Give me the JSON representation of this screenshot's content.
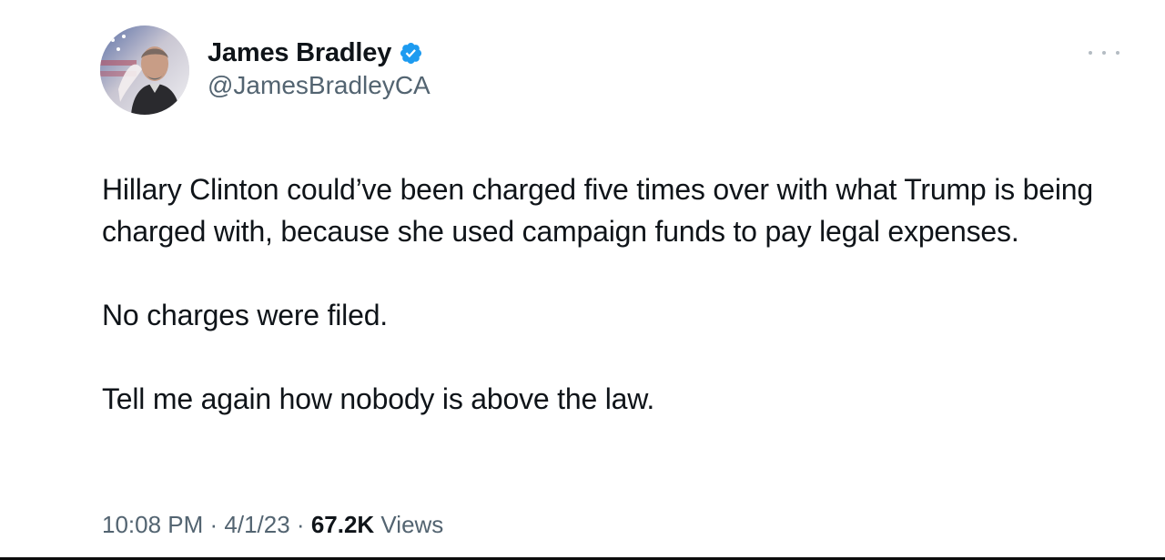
{
  "author": {
    "display_name": "James Bradley",
    "handle": "@JamesBradleyCA",
    "verified": true
  },
  "tweet": {
    "paragraphs": [
      "Hillary Clinton could’ve been charged five times over with what Trump is being charged with, because she used campaign funds to pay legal expenses.",
      "No charges were filed.",
      "Tell me again how nobody is above the law."
    ],
    "time": "10:08 PM",
    "date": "4/1/23",
    "separator": " · ",
    "views_count": "67.2K",
    "views_label": " Views"
  },
  "colors": {
    "text": "#0f1419",
    "secondary": "#536471",
    "verified": "#1d9bf0"
  },
  "icons": {
    "verified": "verified-badge-icon",
    "more": "more-options-icon"
  }
}
